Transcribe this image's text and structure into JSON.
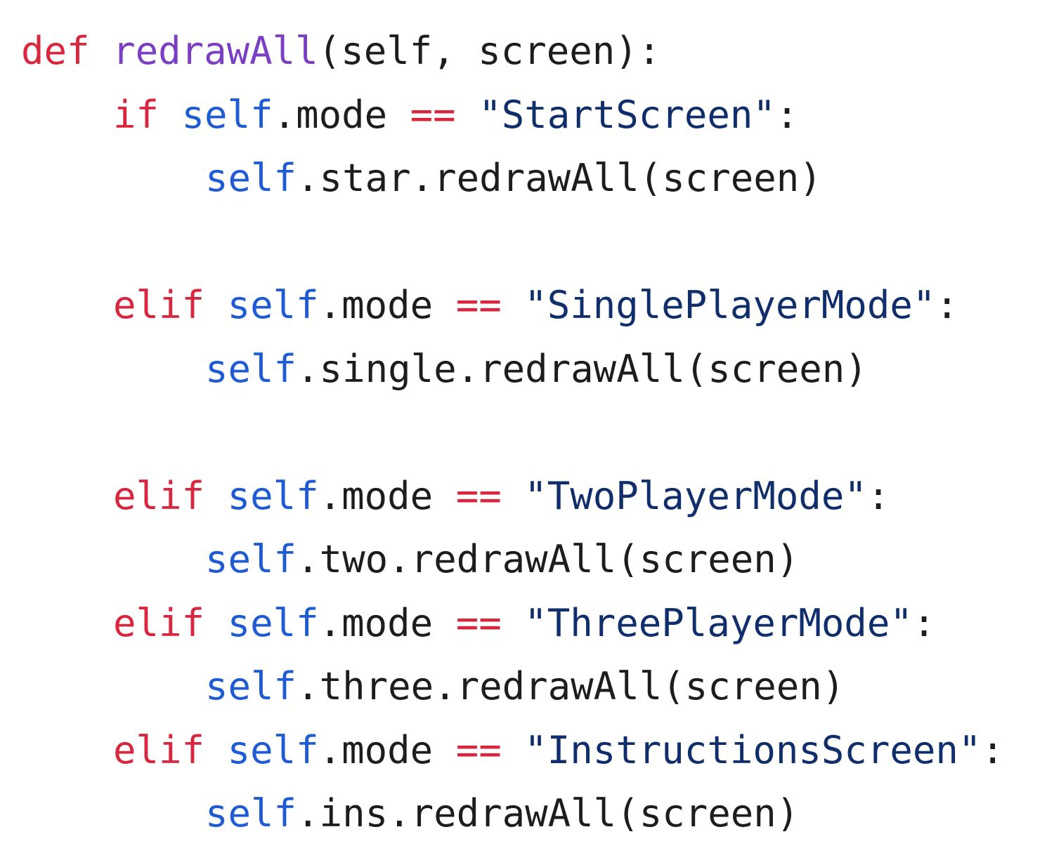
{
  "code": {
    "lines": [
      {
        "kind": "def",
        "keyword": "def",
        "name": "redrawAll",
        "params": "(self, screen):"
      },
      {
        "kind": "cond",
        "keyword": "if",
        "self": "self",
        "attr": ".mode",
        "op": "==",
        "str": "\"StartScreen\"",
        "colon": ":"
      },
      {
        "kind": "call",
        "self": "self",
        "rest": ".star.redrawAll(screen)"
      },
      {
        "kind": "blank"
      },
      {
        "kind": "cond",
        "keyword": "elif",
        "self": "self",
        "attr": ".mode",
        "op": "==",
        "str": "\"SinglePlayerMode\"",
        "colon": ":"
      },
      {
        "kind": "call",
        "self": "self",
        "rest": ".single.redrawAll(screen)"
      },
      {
        "kind": "blank"
      },
      {
        "kind": "cond",
        "keyword": "elif",
        "self": "self",
        "attr": ".mode",
        "op": "==",
        "str": "\"TwoPlayerMode\"",
        "colon": ":"
      },
      {
        "kind": "call",
        "self": "self",
        "rest": ".two.redrawAll(screen)"
      },
      {
        "kind": "cond",
        "keyword": "elif",
        "self": "self",
        "attr": ".mode",
        "op": "==",
        "str": "\"ThreePlayerMode\"",
        "colon": ":"
      },
      {
        "kind": "call",
        "self": "self",
        "rest": ".three.redrawAll(screen)"
      },
      {
        "kind": "cond",
        "keyword": "elif",
        "self": "self",
        "attr": ".mode",
        "op": "==",
        "str": "\"InstructionsScreen\"",
        "colon": ":"
      },
      {
        "kind": "call",
        "self": "self",
        "rest": ".ins.redrawAll(screen)"
      }
    ]
  },
  "colors": {
    "keyword": "#d7263d",
    "function_name": "#7b3fc4",
    "self": "#1f5bd2",
    "string": "#0f2e6b",
    "text": "#1d1d1f",
    "background": "#ffffff"
  }
}
